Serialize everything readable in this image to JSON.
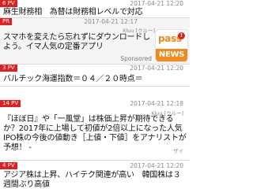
{
  "feed": {
    "items": [
      {
        "badge": "6 PV",
        "date": "2017-04-21 12:20",
        "title": "麻生財務相　為替は財務相レベルで対応"
      },
      {
        "badge": "PR",
        "date": "2017-04-21 12:17",
        "source": "Kluu [クルー]",
        "title": "スマホを変えたら忘れずにダウンロードしよう。イマ人気の定番アプリ",
        "sponsored": "Sponsored",
        "logo_top": "pass",
        "logo_dot": "!",
        "logo_bottom": "NEWS"
      },
      {
        "badge": "3 PV",
        "date": "2017-04-21 12:20",
        "title": "バルチック海運指数＝０４／２０時点＝"
      },
      {
        "badge": "14 PV",
        "date": "2017-04-21 12:18",
        "source": "Kluu [クルー]",
        "title": "『ほぼ日』や「一風堂」は株価上昇が期待できるか？2017年に上場して初値が2倍以上になった人気IPO株の今後の値動き［上値・下値］をアナリストが予想！ -",
        "source2": "ザイ"
      },
      {
        "badge": "4 PV",
        "date": "2017-04-21 12:20",
        "title": "アジア株は上昇、ハイテク関連が高い　韓国株は３週間ぶり高値"
      }
    ]
  }
}
